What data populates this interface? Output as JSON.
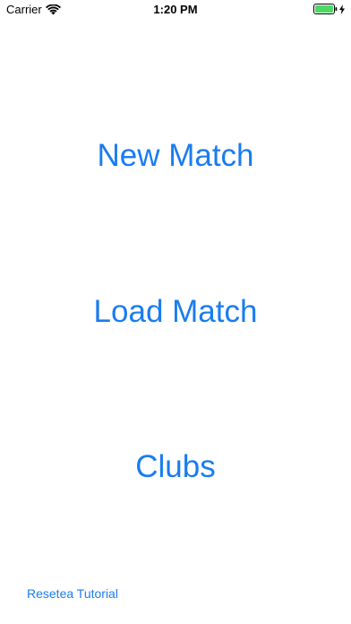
{
  "status_bar": {
    "carrier": "Carrier",
    "time": "1:20 PM",
    "battery_color": "#4cd964",
    "wifi_icon": "wifi-icon",
    "battery_icon": "battery-icon",
    "charging_icon": "charging-bolt-icon"
  },
  "menu": {
    "new_match": "New Match",
    "load_match": "Load Match",
    "clubs": "Clubs"
  },
  "footer": {
    "reset_tutorial": "Resetea Tutorial"
  },
  "colors": {
    "accent": "#1a7cf0",
    "background": "#ffffff"
  }
}
